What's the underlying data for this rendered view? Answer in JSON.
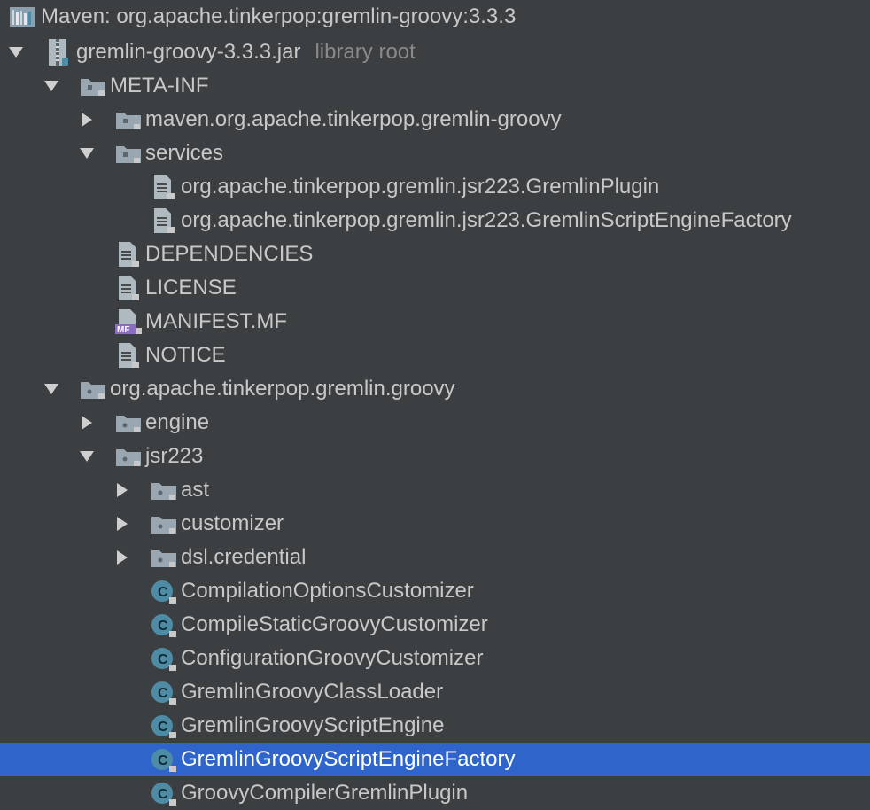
{
  "header": {
    "title": "Maven: org.apache.tinkerpop:gremlin-groovy:3.3.3",
    "icon": "library-icon"
  },
  "tree": [
    {
      "id": "jar",
      "label": "gremlin-groovy-3.3.3.jar",
      "suffix": "library root",
      "icon": "jar-icon",
      "expanded": true
    },
    {
      "id": "meta-inf",
      "label": "META-INF",
      "icon": "folder-icon",
      "expanded": true
    },
    {
      "id": "maven",
      "label": "maven.org.apache.tinkerpop.gremlin-groovy",
      "icon": "folder-icon",
      "expanded": false
    },
    {
      "id": "services",
      "label": "services",
      "icon": "folder-icon",
      "expanded": true
    },
    {
      "id": "svc1",
      "label": "org.apache.tinkerpop.gremlin.jsr223.GremlinPlugin",
      "icon": "text-file-icon"
    },
    {
      "id": "svc2",
      "label": "org.apache.tinkerpop.gremlin.jsr223.GremlinScriptEngineFactory",
      "icon": "text-file-icon"
    },
    {
      "id": "deps",
      "label": "DEPENDENCIES",
      "icon": "text-file-icon"
    },
    {
      "id": "license",
      "label": "LICENSE",
      "icon": "text-file-icon"
    },
    {
      "id": "manifest",
      "label": "MANIFEST.MF",
      "icon": "manifest-file-icon"
    },
    {
      "id": "notice",
      "label": "NOTICE",
      "icon": "text-file-icon"
    },
    {
      "id": "pkg",
      "label": "org.apache.tinkerpop.gremlin.groovy",
      "icon": "package-icon",
      "expanded": true
    },
    {
      "id": "engine",
      "label": "engine",
      "icon": "package-icon",
      "expanded": false
    },
    {
      "id": "jsr223",
      "label": "jsr223",
      "icon": "package-icon",
      "expanded": true
    },
    {
      "id": "ast",
      "label": "ast",
      "icon": "package-icon",
      "expanded": false
    },
    {
      "id": "customizer",
      "label": "customizer",
      "icon": "package-icon",
      "expanded": false
    },
    {
      "id": "dsl",
      "label": "dsl.credential",
      "icon": "package-icon",
      "expanded": false
    },
    {
      "id": "c1",
      "label": "CompilationOptionsCustomizer",
      "icon": "class-icon"
    },
    {
      "id": "c2",
      "label": "CompileStaticGroovyCustomizer",
      "icon": "class-icon"
    },
    {
      "id": "c3",
      "label": "ConfigurationGroovyCustomizer",
      "icon": "class-icon"
    },
    {
      "id": "c4",
      "label": "GremlinGroovyClassLoader",
      "icon": "class-icon"
    },
    {
      "id": "c5",
      "label": "GremlinGroovyScriptEngine",
      "icon": "class-icon"
    },
    {
      "id": "c6",
      "label": "GremlinGroovyScriptEngineFactory",
      "icon": "class-icon",
      "selected": true
    },
    {
      "id": "c7",
      "label": "GroovyCompilerGremlinPlugin",
      "icon": "class-icon"
    }
  ],
  "manifest_badge": "MF",
  "class_badge": "C",
  "colors": {
    "background": "#3c3f41",
    "selection": "#2f65ca",
    "class_icon": "#4e8ca6",
    "folder_icon": "#9aa7b0",
    "manifest_badge": "#8a6dbf"
  }
}
